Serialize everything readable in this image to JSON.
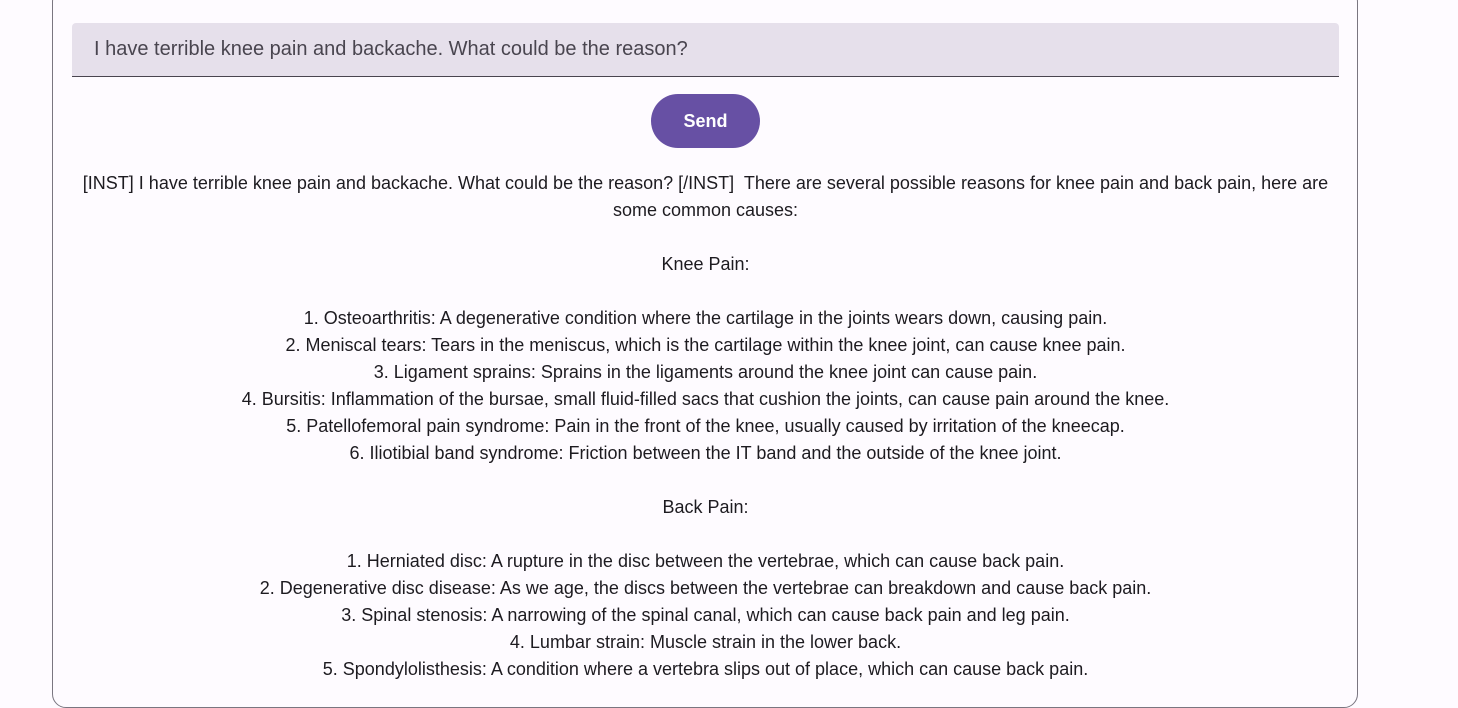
{
  "input": {
    "value": "I have terrible knee pain and backache. What could be the reason?"
  },
  "send_button": {
    "label": "Send"
  },
  "response": {
    "intro": "[INST] I have terrible knee pain and backache. What could be the reason? [/INST]  There are several possible reasons for knee pain and back pain, here are some common causes:",
    "knee_heading": "Knee Pain:",
    "knee_items": [
      "1. Osteoarthritis: A degenerative condition where the cartilage in the joints wears down, causing pain.",
      "2. Meniscal tears: Tears in the meniscus, which is the cartilage within the knee joint, can cause knee pain.",
      "3. Ligament sprains: Sprains in the ligaments around the knee joint can cause pain.",
      "4. Bursitis: Inflammation of the bursae, small fluid-filled sacs that cushion the joints, can cause pain around the knee.",
      "5. Patellofemoral pain syndrome: Pain in the front of the knee, usually caused by irritation of the kneecap.",
      "6. Iliotibial band syndrome: Friction between the IT band and the outside of the knee joint."
    ],
    "back_heading": "Back Pain:",
    "back_items": [
      "1. Herniated disc: A rupture in the disc between the vertebrae, which can cause back pain.",
      "2. Degenerative disc disease: As we age, the discs between the vertebrae can breakdown and cause back pain.",
      "3. Spinal stenosis: A narrowing of the spinal canal, which can cause back pain and leg pain.",
      "4. Lumbar strain: Muscle strain in the lower back.",
      "5. Spondylolisthesis: A condition where a vertebra slips out of place, which can cause back pain."
    ]
  },
  "colors": {
    "accent": "#6750a4",
    "field_bg": "#e6e0eb",
    "page_bg": "#fefbff"
  }
}
